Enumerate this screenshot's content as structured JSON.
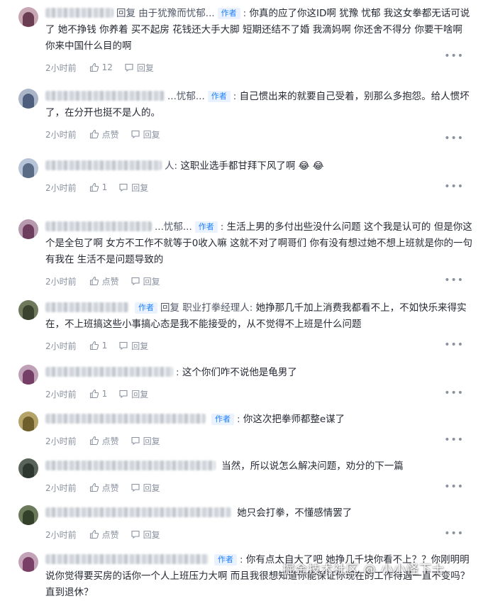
{
  "labels": {
    "author_tag": "作者",
    "reply_word": "回复",
    "reply_action": "回复",
    "like_default": "点赞"
  },
  "comments": [
    {
      "reply_target": "由于犹豫而忧郁...",
      "show_tag": true,
      "text": "你真的应了你这ID啊 犹豫 忧郁 我这女拳都无话可说了 她不挣钱 你养着 买不起房 花钱还大手大脚 短期还结不了婚 我滴妈啊 你还舍不得分 你要干啥啊 你来中国什么目的啊",
      "time": "2小时前",
      "likes": "12"
    },
    {
      "reply_target": "...忧郁...",
      "show_tag": true,
      "text": "自己惯出来的就要自己受着，别那么多抱怨。给人惯坏了，在分开也挺不是人的。",
      "time": "2小时前",
      "likes": "点赞"
    },
    {
      "reply_target": "人",
      "show_tag": false,
      "text": "这职业选手都甘拜下风了啊 😂 😂",
      "time": "2小时前",
      "likes": "1"
    },
    {
      "reply_target": "...忧郁...",
      "show_tag": true,
      "text": "生活上男的多付出些没什么问题 这个我是认可的 但是你这个是全包了啊 女方不工作不就等于0收入嘛 这就不对了啊哥们 你有没有想过她不想上班就是你的一句有我在 生活不是问题导致的",
      "time": "2小时前",
      "likes": "点赞"
    },
    {
      "reply_target": "职业打拳经理人",
      "show_tag": true,
      "text": "她挣那几千加上消费我都看不上，不如快乐来得实在，不上班搞这些小事搞心态是我不能接受的，从不觉得不上班是什么问题",
      "time": "2小时前",
      "likes": "1"
    },
    {
      "reply_target": "",
      "show_tag": false,
      "text": "这个你们咋不说他是龟男了",
      "time": "2小时前",
      "likes": "1"
    },
    {
      "reply_target": "",
      "show_tag": true,
      "text": "你这次把拳师都整e谋了",
      "time": "2小时前",
      "likes": "点赞"
    },
    {
      "reply_target": "",
      "show_tag": false,
      "text": "当然，所以说怎么解决问题，劝分的下一篇",
      "time": "2小时前",
      "likes": "点赞"
    },
    {
      "reply_target": "",
      "show_tag": false,
      "text": "她只会打拳，不懂感情罢了",
      "time": "2小时前",
      "likes": "点赞"
    },
    {
      "reply_target": "",
      "show_tag": true,
      "text": "你有点太自大了吧 她挣几千块你看不上？？你刚明明说你觉得要买房的话你一个人上班压力大啊 而且我很想知道你能保证你现在的工作待遇一直不变吗？直到退休？",
      "time": "",
      "likes": ""
    }
  ],
  "watermark": "掘金技术社区 @ 小小怪下士"
}
